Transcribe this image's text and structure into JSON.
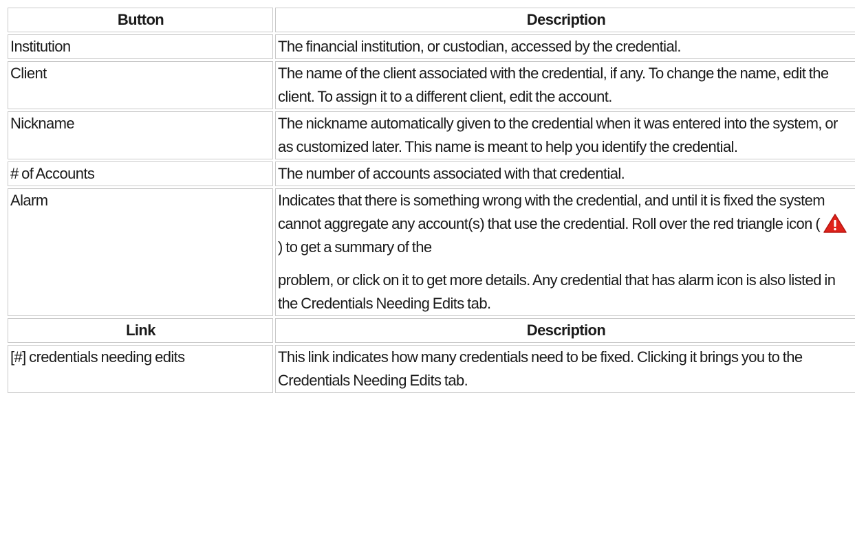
{
  "button_table": {
    "header": {
      "col1": "Button",
      "col2": "Description"
    },
    "rows": [
      {
        "name": "Institution",
        "desc": "The financial institution, or custodian, accessed by the credential."
      },
      {
        "name": "Client",
        "desc": "The name of the client associated with the credential, if any. To change the name, edit the client. To assign it to a different client, edit the account."
      },
      {
        "name": "Nickname",
        "desc": "The nickname automatically given to the credential when it was entered into the system, or as customized later. This name is meant to help you identify the credential."
      },
      {
        "name": "# of Accounts",
        "desc": "The number of accounts associated with that credential."
      },
      {
        "name": "Alarm",
        "desc_before_icon": "Indicates that there is something wrong with the credential, and until it is fixed the system cannot aggregate any account(s) that use the credential. Roll over the red triangle icon (",
        "desc_after_icon": ") to get a summary of the",
        "desc_continued": "problem, or click on it to get more details. Any credential that has alarm icon is also listed in the Credentials Needing Edits tab.",
        "icon": "red-triangle-alarm-icon"
      }
    ]
  },
  "link_table": {
    "header": {
      "col1": "Link",
      "col2": "Description"
    },
    "rows": [
      {
        "name": "[#] credentials needing edits",
        "desc": "This link indicates how many credentials need to be fixed. Clicking it brings you to the Credentials Needing Edits tab."
      }
    ]
  },
  "colors": {
    "alarm_icon": "#e0221b",
    "border": "#c9c9c9"
  }
}
